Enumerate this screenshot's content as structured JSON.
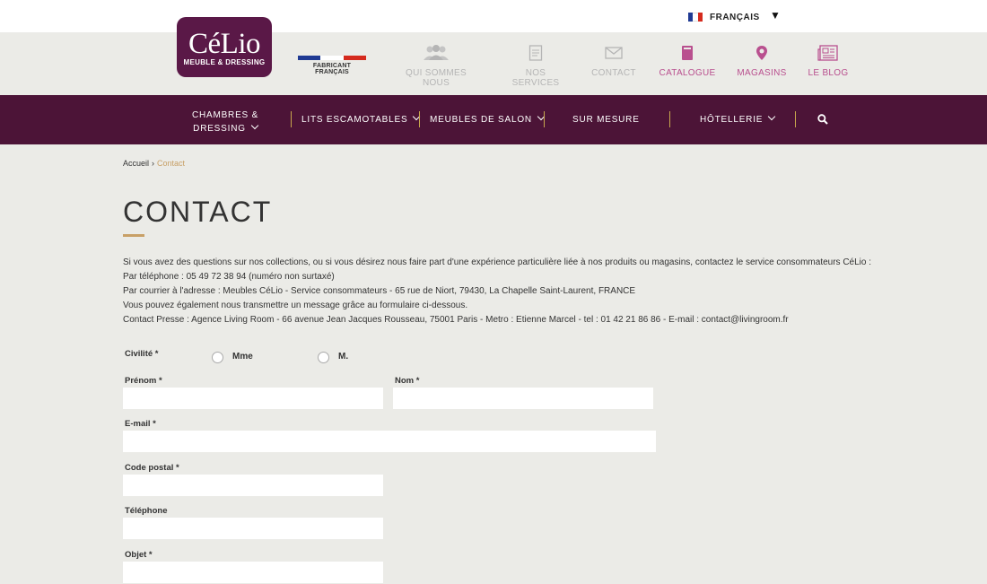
{
  "language": {
    "label": "FRANÇAIS",
    "flag_colors": [
      "#1f3a93",
      "#ffffff",
      "#d52b1e"
    ]
  },
  "brand": {
    "name": "CéLio",
    "tagline": "MEUBLE & DRESSING",
    "color": "#5a1847"
  },
  "fabricant": {
    "label": "FABRICANT FRANÇAIS"
  },
  "topnav": [
    {
      "label": "QUI SOMMES NOUS",
      "icon": "people-icon"
    },
    {
      "label": "NOS SERVICES",
      "icon": "document-icon"
    },
    {
      "label": "CONTACT",
      "icon": "envelope-icon"
    },
    {
      "label": "CATALOGUE",
      "icon": "book-icon"
    },
    {
      "label": "MAGASINS",
      "icon": "map-pin-icon"
    },
    {
      "label": "LE BLOG",
      "icon": "newspaper-icon"
    }
  ],
  "mainnav": [
    {
      "line1": "CHAMBRES &",
      "line2": "DRESSING"
    },
    {
      "label": "LITS ESCAMOTABLES"
    },
    {
      "label": "MEUBLES DE SALON"
    },
    {
      "label": "SUR MESURE"
    },
    {
      "label": "HÔTELLERIE"
    }
  ],
  "breadcrumb": {
    "home": "Accueil",
    "separator": "›",
    "current": "Contact"
  },
  "page": {
    "title": "CONTACT",
    "intro": [
      "Si vous avez des questions sur nos collections, ou si vous désirez nous faire part d'une expérience particulière liée à nos produits ou magasins, contactez le service consommateurs CéLio :",
      "Par téléphone : 05 49 72 38 94 (numéro non surtaxé)",
      "Par courrier à l'adresse : Meubles CéLio - Service consommateurs - 65 rue de Niort, 79430, La Chapelle Saint-Laurent, FRANCE",
      "Vous pouvez également nous transmettre un message grâce au formulaire ci-dessous.",
      "Contact Presse : Agence Living Room - 66 avenue Jean Jacques Rousseau, 75001 Paris - Metro : Etienne Marcel - tel : 01 42 21 86 86 - E-mail : contact@livingroom.fr"
    ]
  },
  "form": {
    "civilite_label": "Civilité *",
    "civilite_options": [
      "Mme",
      "M."
    ],
    "prenom_label": "Prénom *",
    "nom_label": "Nom *",
    "email_label": "E-mail *",
    "code_postal_label": "Code postal *",
    "telephone_label": "Téléphone",
    "objet_label": "Objet *",
    "prenom_value": "",
    "nom_value": "",
    "email_value": "",
    "code_postal_value": "",
    "telephone_value": "",
    "objet_value": ""
  },
  "colors": {
    "nav_bg": "#4c1437",
    "accent_gold": "#c8a067",
    "accent_pink": "#b9508f",
    "page_bg": "#ebebe7"
  }
}
